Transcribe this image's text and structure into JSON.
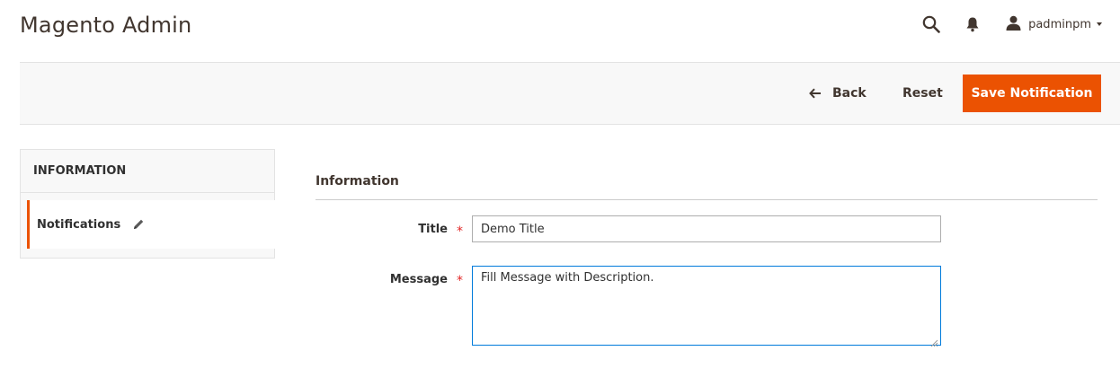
{
  "header": {
    "title": "Magento Admin",
    "user_name": "padminpm",
    "icons": [
      "search-icon",
      "bell-icon",
      "user-icon",
      "caret-down-icon"
    ]
  },
  "actions": {
    "back_label": "Back",
    "reset_label": "Reset",
    "save_label": "Save Notification"
  },
  "sidebar": {
    "title": "INFORMATION",
    "items": [
      {
        "label": "Notifications",
        "icon": "pencil-icon",
        "active": true
      }
    ]
  },
  "form": {
    "fieldset_title": "Information",
    "fields": {
      "title": {
        "label": "Title",
        "value": "Demo Title",
        "required_mark": "*"
      },
      "message": {
        "label": "Message",
        "value": "Fill Message with Description.",
        "required_mark": "*"
      }
    }
  },
  "colors": {
    "accent": "#eb5202",
    "required": "#e22626",
    "focus_border": "#007bdb",
    "text": "#41362f"
  }
}
